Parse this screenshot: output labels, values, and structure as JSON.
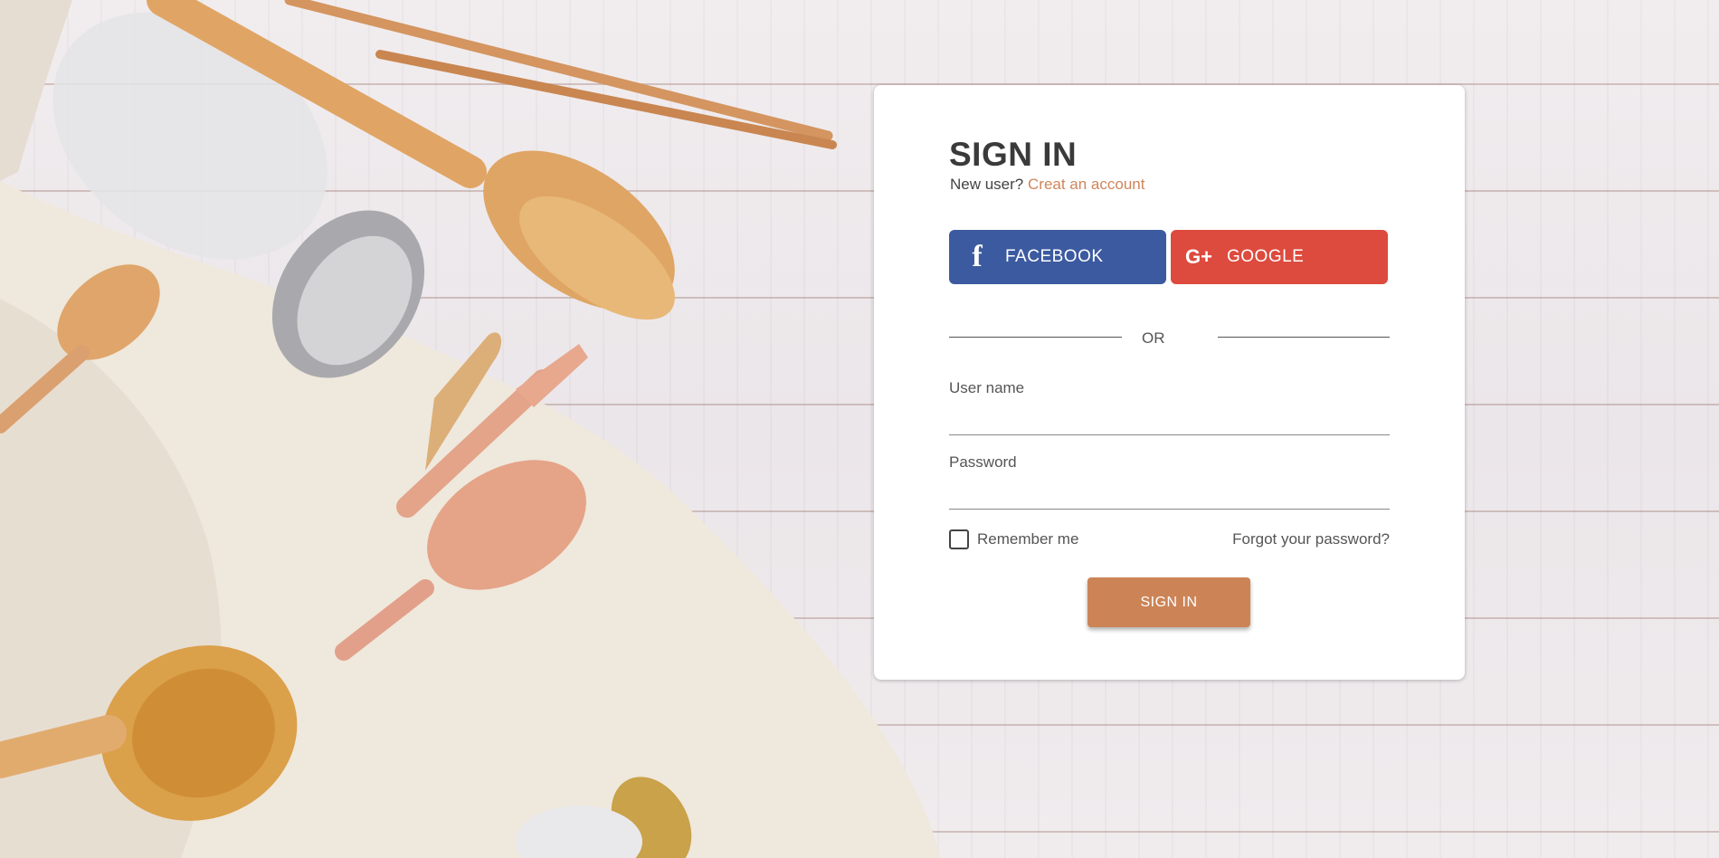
{
  "signin": {
    "title": "SIGN IN",
    "new_user_text": "New user?",
    "create_account_link": "Creat an account",
    "facebook_label": "FACEBOOK",
    "google_label": "GOOGLE",
    "or_text": "OR",
    "username_label": "User name",
    "username_value": "",
    "password_label": "Password",
    "password_value": "",
    "remember_me_label": "Remember me",
    "remember_me_checked": false,
    "forgot_password_link": "Forgot your password?",
    "submit_label": "SIGN IN"
  },
  "icons": {
    "facebook": "f",
    "google": "G+"
  },
  "colors": {
    "accent": "#cc8456",
    "link": "#cf855c",
    "facebook": "#3c5aa0",
    "google": "#dd4b3e",
    "title": "#3a3a3a"
  }
}
